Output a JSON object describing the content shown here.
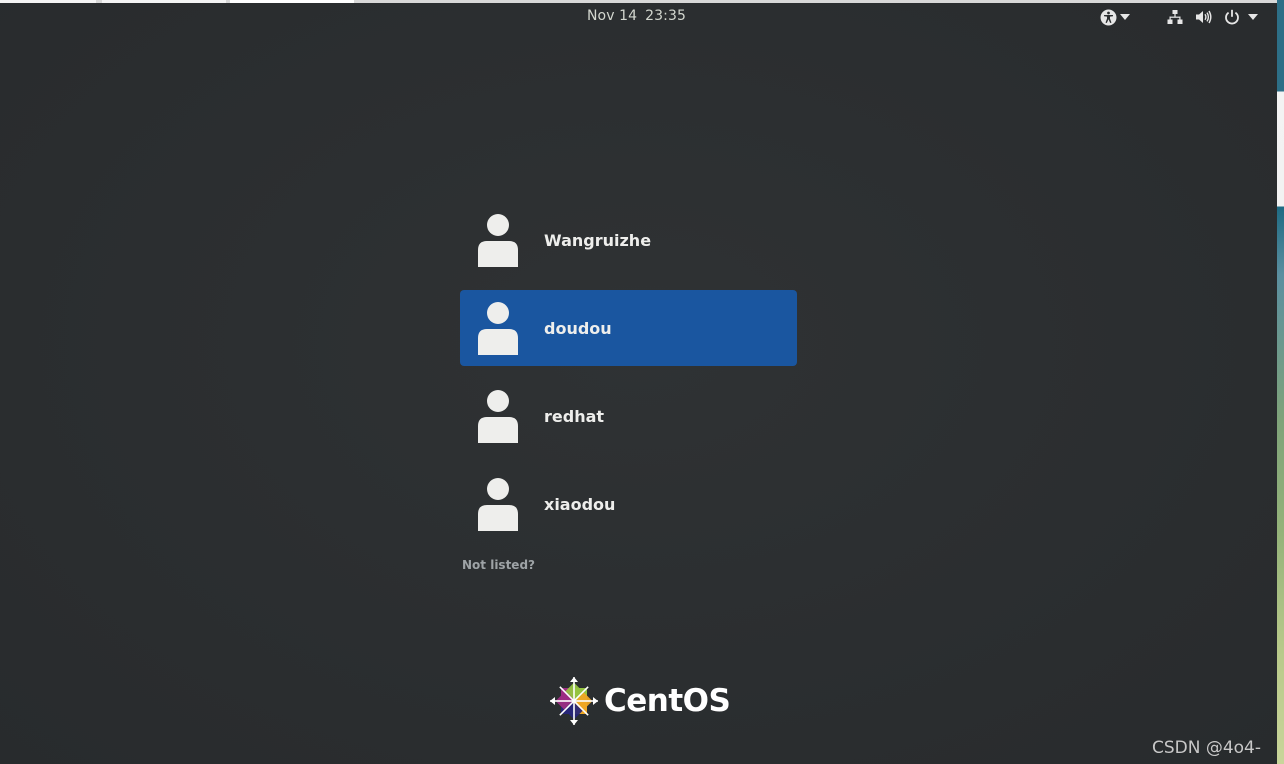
{
  "topbar": {
    "date": "Nov 14",
    "time": "23:35",
    "icons": [
      "accessibility-icon",
      "network-icon",
      "volume-icon",
      "power-icon"
    ]
  },
  "users": [
    {
      "name": "Wangruizhe",
      "selected": false
    },
    {
      "name": "doudou",
      "selected": true
    },
    {
      "name": "redhat",
      "selected": false
    },
    {
      "name": "xiaodou",
      "selected": false
    }
  ],
  "not_listed_label": "Not listed?",
  "logo": {
    "wordmark": "CentOS"
  },
  "watermark": "CSDN @4o4-",
  "colors": {
    "background": "#2b2e30",
    "selection": "#1a56a0",
    "text": "#eeeeec",
    "muted": "#9ea3a6"
  }
}
